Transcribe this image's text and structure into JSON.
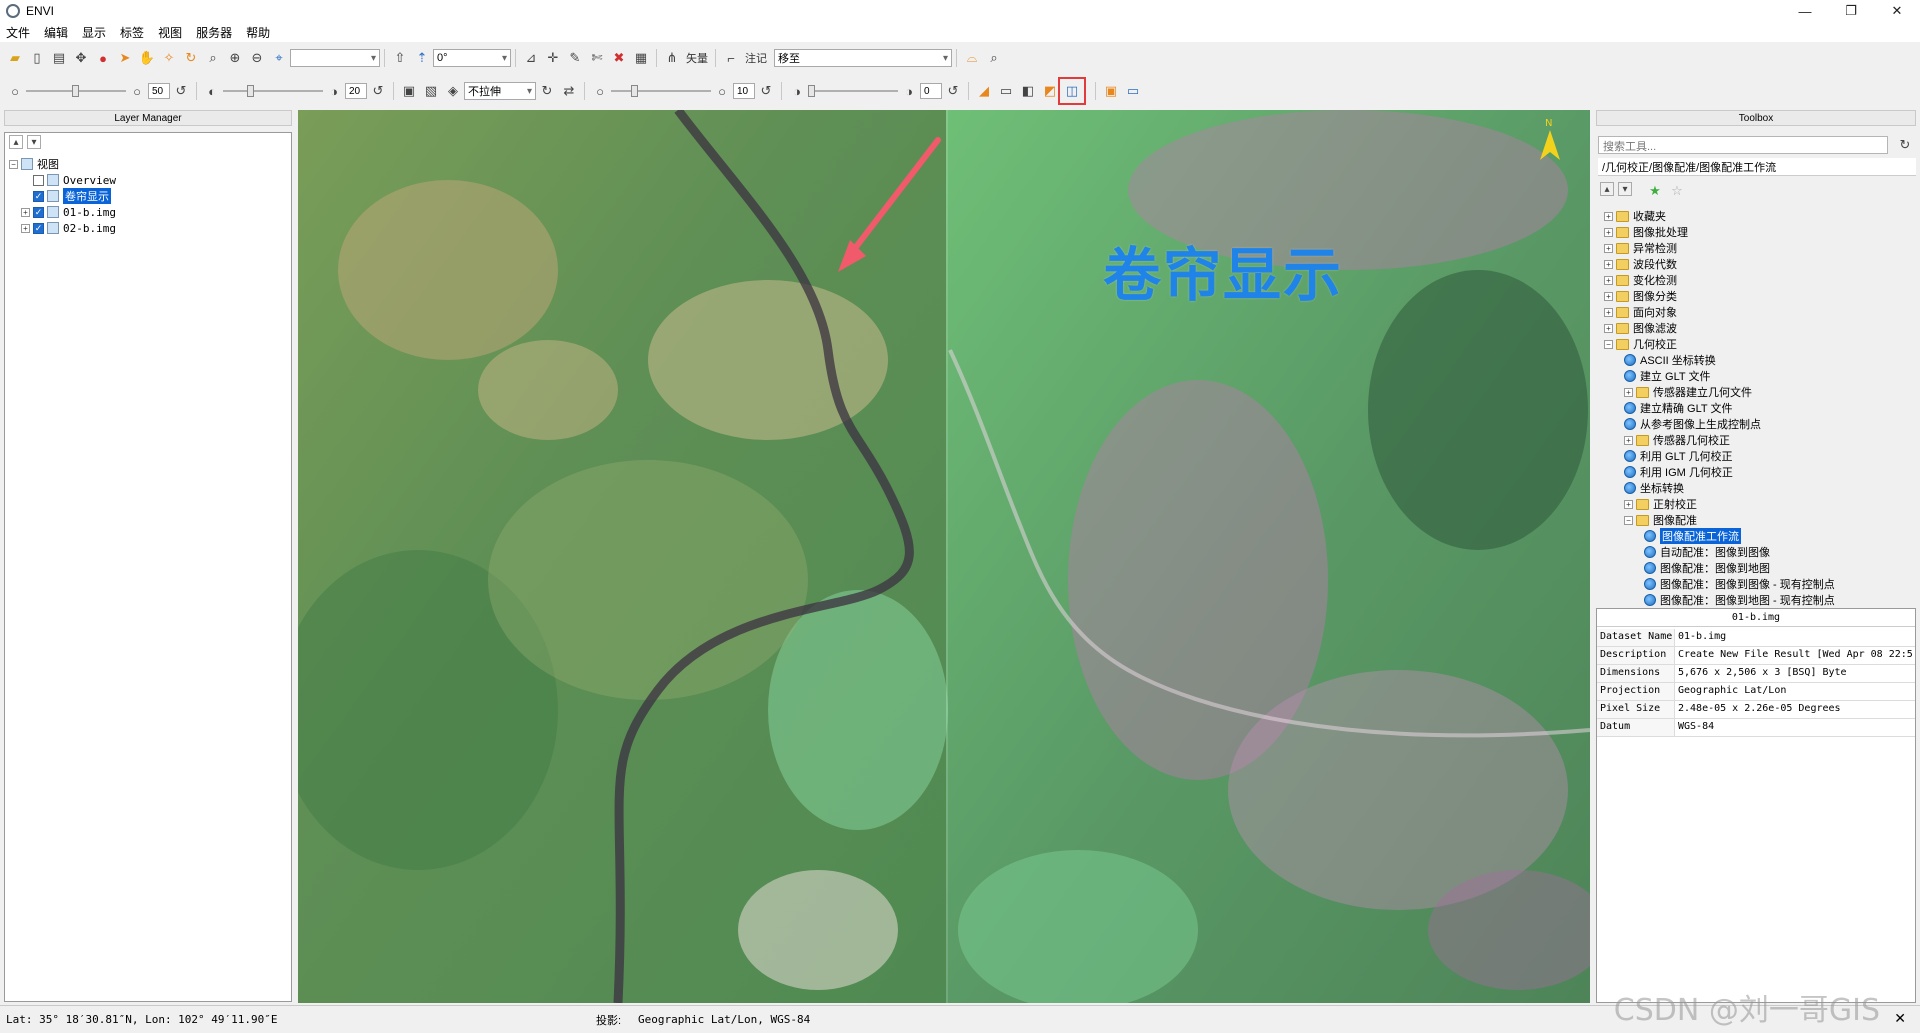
{
  "window": {
    "title": "ENVI",
    "controls": [
      "—",
      "❐",
      "✕"
    ]
  },
  "menu": [
    "文件",
    "编辑",
    "显示",
    "标签",
    "视图",
    "服务器",
    "帮助"
  ],
  "toolbar1": {
    "rotation_value": "0°",
    "vector_label": "矢量",
    "annotation_label": "注记",
    "goto_value": "移至"
  },
  "toolbar2": {
    "brightness_value": "50",
    "contrast_value": "20",
    "stretch_value": "不拉伸",
    "sharpen_value": "10",
    "transparency_value": "0"
  },
  "layer_manager": {
    "title": "Layer Manager",
    "root": "视图",
    "items": [
      {
        "label": "Overview",
        "checked": false
      },
      {
        "label": "卷帘显示",
        "checked": true,
        "selected": true
      },
      {
        "label": "01-b.img",
        "checked": true
      },
      {
        "label": "02-b.img",
        "checked": true
      }
    ]
  },
  "map": {
    "annotation": "卷帘显示",
    "north_label": "N"
  },
  "toolbox": {
    "title": "Toolbox",
    "search_placeholder": "搜索工具...",
    "path": "/几何校正/图像配准/图像配准工作流",
    "items": [
      {
        "label": "收藏夹",
        "level": 0,
        "type": "folder"
      },
      {
        "label": "图像批处理",
        "level": 0,
        "type": "folder"
      },
      {
        "label": "异常检测",
        "level": 0,
        "type": "folder"
      },
      {
        "label": "波段代数",
        "level": 0,
        "type": "folder"
      },
      {
        "label": "变化检测",
        "level": 0,
        "type": "folder"
      },
      {
        "label": "图像分类",
        "level": 0,
        "type": "folder"
      },
      {
        "label": "面向对象",
        "level": 0,
        "type": "folder"
      },
      {
        "label": "图像滤波",
        "level": 0,
        "type": "folder"
      },
      {
        "label": "几何校正",
        "level": 0,
        "type": "folder",
        "open": true
      },
      {
        "label": "ASCII 坐标转换",
        "level": 1,
        "type": "tool"
      },
      {
        "label": "建立 GLT 文件",
        "level": 1,
        "type": "tool"
      },
      {
        "label": "传感器建立几何文件",
        "level": 1,
        "type": "folder"
      },
      {
        "label": "建立精确 GLT 文件",
        "level": 1,
        "type": "tool"
      },
      {
        "label": "从参考图像上生成控制点",
        "level": 1,
        "type": "tool"
      },
      {
        "label": "传感器几何校正",
        "level": 1,
        "type": "folder"
      },
      {
        "label": "利用 GLT 几何校正",
        "level": 1,
        "type": "tool"
      },
      {
        "label": "利用 IGM 几何校正",
        "level": 1,
        "type": "tool"
      },
      {
        "label": "坐标转换",
        "level": 1,
        "type": "tool"
      },
      {
        "label": "正射校正",
        "level": 1,
        "type": "folder"
      },
      {
        "label": "图像配准",
        "level": 1,
        "type": "folder",
        "open": true
      },
      {
        "label": "图像配准工作流",
        "level": 2,
        "type": "tool",
        "selected": true
      },
      {
        "label": "自动配准：图像到图像",
        "level": 2,
        "type": "tool"
      },
      {
        "label": "图像配准：图像到地图",
        "level": 2,
        "type": "tool"
      },
      {
        "label": "图像配准：图像到图像 - 现有控制点",
        "level": 2,
        "type": "tool"
      },
      {
        "label": "图像配准：图像到地图 - 现有控制点",
        "level": 2,
        "type": "tool"
      }
    ]
  },
  "properties": {
    "header": "01-b.img",
    "rows": [
      {
        "key": "Dataset Name",
        "value": "01-b.img"
      },
      {
        "key": "Description",
        "value": "Create New File Result [Wed Apr 08 22:5"
      },
      {
        "key": "Dimensions",
        "value": "5,676 x 2,506 x 3 [BSQ] Byte"
      },
      {
        "key": "Projection",
        "value": "Geographic Lat/Lon"
      },
      {
        "key": "Pixel Size",
        "value": "2.48e-05 x 2.26e-05 Degrees"
      },
      {
        "key": "Datum",
        "value": "WGS-84"
      }
    ]
  },
  "status": {
    "coords": "Lat: 35° 18′30.81″N, Lon: 102° 49′11.90″E",
    "projection_label": "投影:",
    "projection": "Geographic Lat/Lon, WGS-84"
  },
  "watermark": "CSDN @刘一哥GIS"
}
